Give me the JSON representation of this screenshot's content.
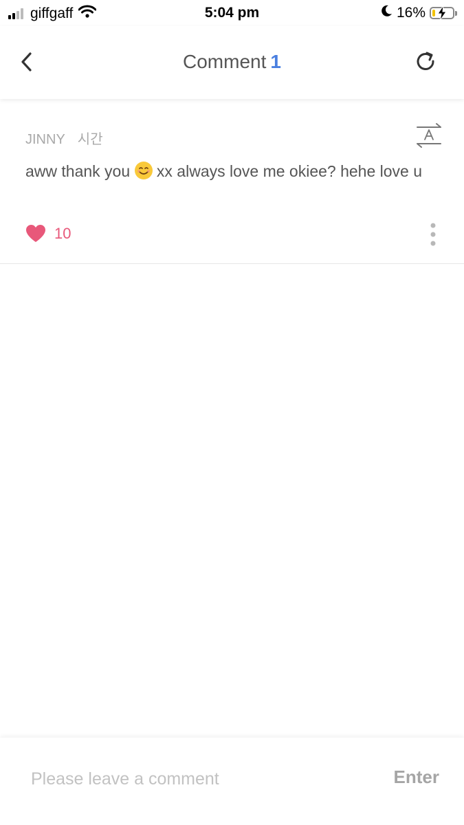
{
  "status_bar": {
    "carrier": "giffgaff",
    "time": "5:04 pm",
    "battery_percent": "16%",
    "battery_level": 0.16,
    "signal_bars_active": 2,
    "icons": [
      "signal-icon",
      "wifi-icon",
      "moon-icon",
      "battery-charging-icon"
    ]
  },
  "header": {
    "title": "Comment",
    "count": "1",
    "back_icon": "chevron-left-icon",
    "refresh_icon": "refresh-icon"
  },
  "comment": {
    "author": "JINNY",
    "time": "시간",
    "text_before_emoji": "aww thank you ",
    "emoji": "smiling-face-emoji",
    "text_after_emoji": " xx always love me okiee? hehe love u",
    "likes": "10",
    "translate_icon": "translate-icon",
    "more_icon": "more-vertical-icon"
  },
  "composer": {
    "placeholder": "Please leave a comment",
    "value": "",
    "enter_label": "Enter"
  },
  "colors": {
    "accent_blue": "#4a7fe0",
    "like_pink": "#e8587a",
    "battery_yellow": "#f2c200"
  }
}
